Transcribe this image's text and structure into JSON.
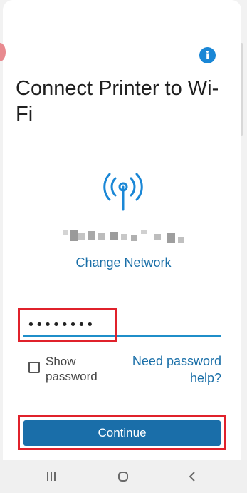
{
  "header": {
    "title": "Connect Printer to Wi-Fi",
    "info_icon": "info-icon",
    "info_glyph": "i"
  },
  "network": {
    "icon": "wifi-signal-icon",
    "change_label": "Change Network"
  },
  "password": {
    "value": "••••••••",
    "highlight_color": "#e0212b"
  },
  "show_password": {
    "label": "Show password",
    "checked": false
  },
  "help_link": {
    "label": "Need password help?"
  },
  "continue_button": {
    "label": "Continue"
  },
  "nav_bar": {
    "recents_icon": "recents-icon",
    "home_icon": "home-icon",
    "back_icon": "back-icon"
  },
  "colors": {
    "accent": "#1a6fa8",
    "info_blue": "#1a87d6",
    "button": "#1a6ea9",
    "highlight": "#e0212b"
  }
}
